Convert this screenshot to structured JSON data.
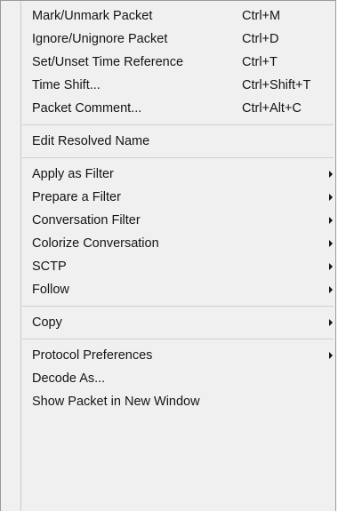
{
  "menu": {
    "items": [
      {
        "label": "Mark/Unmark Packet",
        "shortcut": "Ctrl+M"
      },
      {
        "label": "Ignore/Unignore Packet",
        "shortcut": "Ctrl+D"
      },
      {
        "label": "Set/Unset Time Reference",
        "shortcut": "Ctrl+T"
      },
      {
        "label": "Time Shift...",
        "shortcut": "Ctrl+Shift+T"
      },
      {
        "label": "Packet Comment...",
        "shortcut": "Ctrl+Alt+C"
      },
      {
        "label": "Edit Resolved Name"
      },
      {
        "label": "Apply as Filter",
        "submenu": true
      },
      {
        "label": "Prepare a Filter",
        "submenu": true
      },
      {
        "label": "Conversation Filter",
        "submenu": true
      },
      {
        "label": "Colorize Conversation",
        "submenu": true
      },
      {
        "label": "SCTP",
        "submenu": true
      },
      {
        "label": "Follow",
        "submenu": true
      },
      {
        "label": "Copy",
        "submenu": true
      },
      {
        "label": "Protocol Preferences",
        "submenu": true
      },
      {
        "label": "Decode As..."
      },
      {
        "label": "Show Packet in New Window"
      }
    ]
  }
}
